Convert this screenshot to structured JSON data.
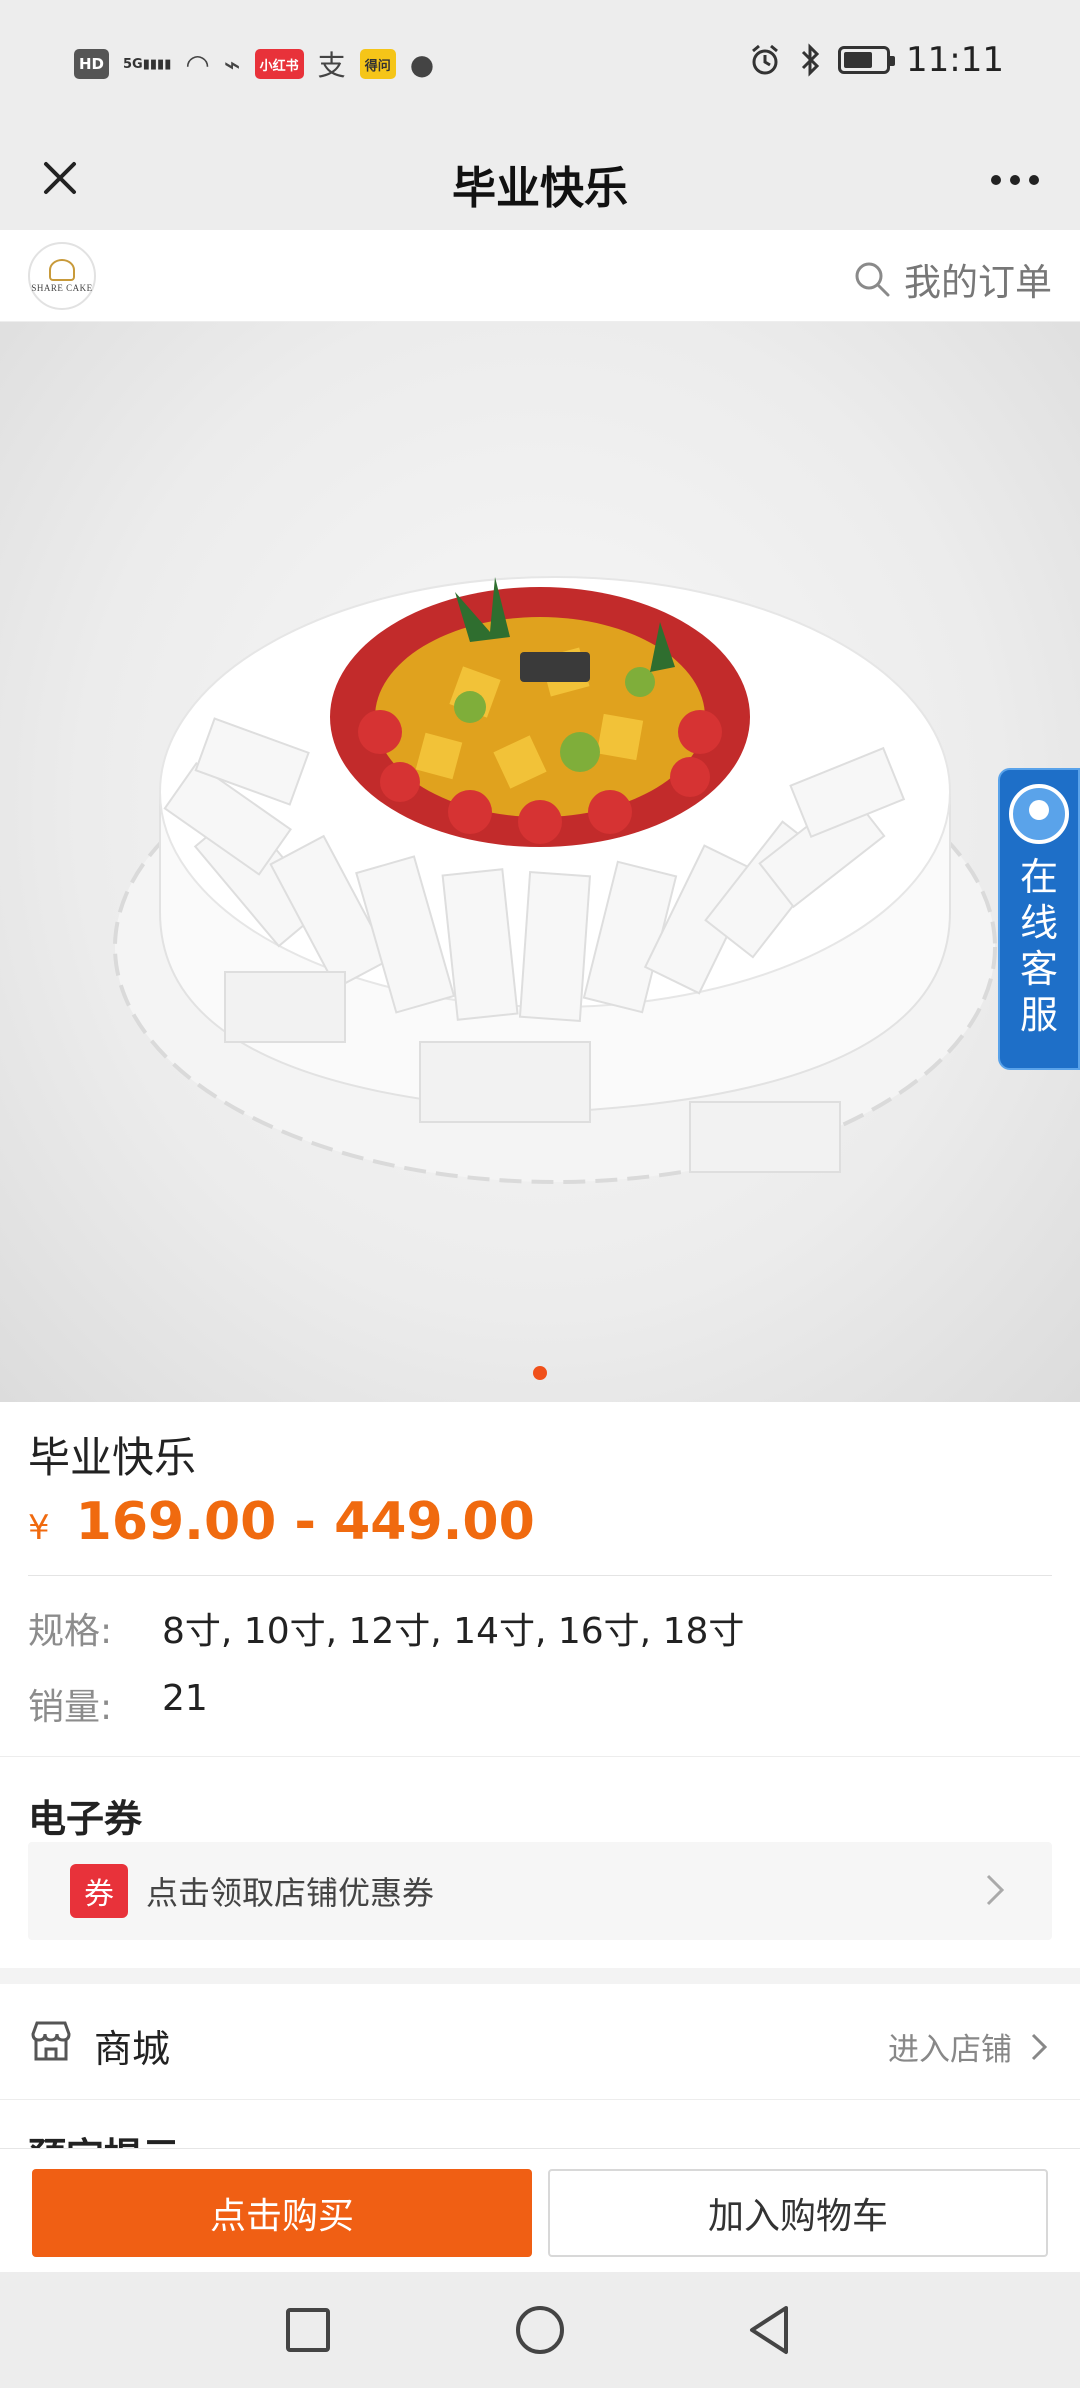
{
  "status_bar": {
    "left_icons": [
      "hd-icon",
      "signal-icon",
      "wifi-icon",
      "link-icon",
      "xiaohongshu-icon",
      "alipay-icon",
      "dewu-icon",
      "wechat-icon"
    ],
    "hd": "HD",
    "sig": "5G",
    "red_app": "小红书",
    "alipay": "支",
    "yellow_app": "得问",
    "time": "11:11",
    "battery_level": 0.7
  },
  "titlebar": {
    "title": "毕业快乐"
  },
  "shop": {
    "logo_text": "SHARE CAKE",
    "orders_label": "我的订单"
  },
  "hero": {
    "slide_count": 1,
    "active_slide": 1
  },
  "customer_service": {
    "label": "在线客服"
  },
  "product": {
    "name": "毕业快乐",
    "currency": "¥",
    "price_range": "169.00 - 449.00",
    "spec_label": "规格:",
    "spec_value": "8寸, 10寸, 12寸, 14寸, 16寸, 18寸",
    "sales_label": "销量:",
    "sales_value": "21"
  },
  "coupon": {
    "section_title": "电子券",
    "badge": "券",
    "text": "点击领取店铺优惠券"
  },
  "mall": {
    "label": "商城",
    "enter": "进入店铺"
  },
  "reserve": {
    "title": "预定提示"
  },
  "actions": {
    "buy": "点击购买",
    "cart": "加入购物车"
  },
  "colors": {
    "accent": "#f05f14",
    "price": "#f06a0f",
    "coupon_badge": "#e8323a",
    "cs_blue": "#1e6fc8"
  }
}
